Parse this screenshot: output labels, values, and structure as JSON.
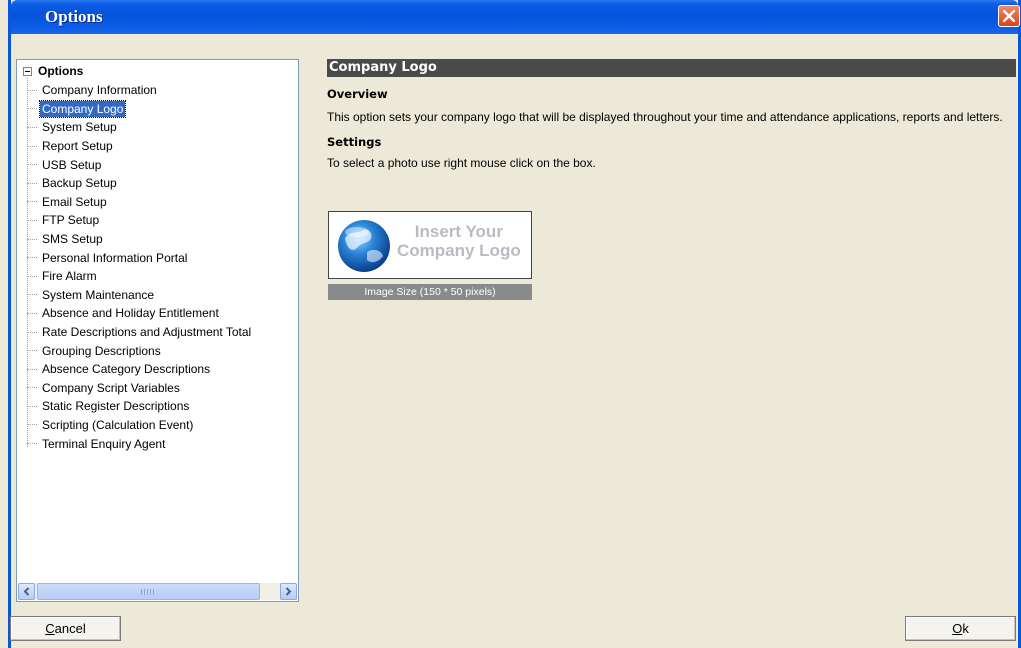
{
  "window": {
    "title": "Options"
  },
  "tree": {
    "root_label": "Options",
    "selected_index": 1,
    "items": [
      {
        "label": "Company Information"
      },
      {
        "label": "Company Logo"
      },
      {
        "label": "System Setup"
      },
      {
        "label": "Report Setup"
      },
      {
        "label": "USB Setup"
      },
      {
        "label": "Backup Setup"
      },
      {
        "label": "Email Setup"
      },
      {
        "label": "FTP Setup"
      },
      {
        "label": "SMS Setup"
      },
      {
        "label": "Personal Information Portal"
      },
      {
        "label": "Fire Alarm"
      },
      {
        "label": "System Maintenance"
      },
      {
        "label": "Absence and Holiday Entitlement"
      },
      {
        "label": "Rate Descriptions and Adjustment Total"
      },
      {
        "label": "Grouping Descriptions"
      },
      {
        "label": "Absence Category Descriptions"
      },
      {
        "label": "Company Script Variables"
      },
      {
        "label": "Static Register Descriptions"
      },
      {
        "label": "Scripting (Calculation Event)"
      },
      {
        "label": "Terminal Enquiry Agent"
      }
    ]
  },
  "content": {
    "section_title": "Company Logo",
    "overview_heading": "Overview",
    "overview_text": "This option sets your company logo that will be displayed throughout your time and attendance applications, reports and letters.",
    "settings_heading": "Settings",
    "settings_text": "To select a photo use right mouse click on the box.",
    "logo_placeholder_line1": "Insert Your",
    "logo_placeholder_line2": "Company Logo",
    "image_size_label": "Image Size (150 * 50 pixels)"
  },
  "buttons": {
    "cancel_accel": "C",
    "cancel_rest": "ancel",
    "ok_accel": "O",
    "ok_rest": "k"
  },
  "icons": {
    "close": "close-icon",
    "collapse": "minus-expander-icon",
    "scroll_left": "chevron-left-icon",
    "scroll_right": "chevron-right-icon",
    "globe": "globe-icon"
  },
  "colors": {
    "titlebar": "#0652d8",
    "selection": "#316ac5",
    "section_header": "#4a4a4a",
    "dialog_bg": "#ece9d8"
  }
}
